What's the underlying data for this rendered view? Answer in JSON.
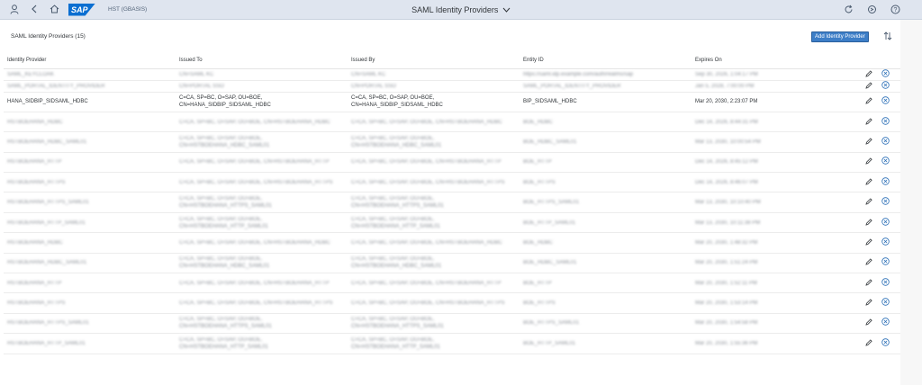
{
  "shell": {
    "system": "HST (GBASIS)",
    "app_title": "SAML Identity Providers",
    "logo_text": "SAP"
  },
  "toolbar": {
    "title": "SAML Identity Providers (15)",
    "add_label": "Add Identity Provider"
  },
  "columns": [
    "Identity Provider",
    "Issued To",
    "Issued By",
    "Entity ID",
    "Expires On"
  ],
  "rows": [
    {
      "idp": "SAML_KEYCLOAK",
      "to": "CN=SAML KC",
      "by": "CN=SAML KC",
      "entity": "https://saml.idp.example.com/auth/realms/sap",
      "exp": "Sep 30, 2026, 1:04:17 PM",
      "two": false,
      "clear": false
    },
    {
      "idp": "SAML_PORTAL_IDENTITY_PROVIDER",
      "to": "CN=PORTAL SSO",
      "by": "CN=PORTAL SSO",
      "entity": "SAML_PORTAL_IDENTITY_PROVIDER",
      "exp": "Jan 5, 2028, 7:00:00 PM",
      "two": false,
      "clear": false
    },
    {
      "idp": "HANA_SIDBIP_SIDSAML_HDBC",
      "to": "C=CA, SP=BC, O=SAP, OU=BOE, CN=HANA_SIDBIP_SIDSAML_HDBC",
      "by": "C=CA, SP=BC, O=SAP, OU=BOE, CN=HANA_SIDBIP_SIDSAML_HDBC",
      "entity": "BIP_SIDSAML_HDBC",
      "exp": "Mar 20, 2030, 2:23:07 PM",
      "two": true,
      "clear": true
    },
    {
      "idp": "HSTBOEHANA_HDBC",
      "to": "C=CA, SP=BC, O=SAP, OU=BOE, CN=HSTBOEHANA_HDBC",
      "by": "C=CA, SP=BC, O=SAP, OU=BOE, CN=HSTBOEHANA_HDBC",
      "entity": "BOE_HDBC",
      "exp": "Dec 14, 2026, 8:44:31 PM",
      "two": true,
      "clear": false
    },
    {
      "idp": "HSTBOEHANA_HDBC_SAML01",
      "to": "C=CA, SP=BC, O=SAP, OU=BOE, CN=HSTBOEHANA_HDBC_SAML01",
      "by": "C=CA, SP=BC, O=SAP, OU=BOE, CN=HSTBOEHANA_HDBC_SAML01",
      "entity": "BOE_HDBC_SAML01",
      "exp": "Mar 13, 2030, 10:00:54 PM",
      "two": true,
      "clear": false
    },
    {
      "idp": "HSTBOEHANA_HTTP",
      "to": "C=CA, SP=BC, O=SAP, OU=BOE, CN=HSTBOEHANA_HTTP",
      "by": "C=CA, SP=BC, O=SAP, OU=BOE, CN=HSTBOEHANA_HTTP",
      "entity": "BOE_HTTP",
      "exp": "Dec 14, 2026, 8:45:12 PM",
      "two": true,
      "clear": false
    },
    {
      "idp": "HSTBOEHANA_HTTPS",
      "to": "C=CA, SP=BC, O=SAP, OU=BOE, CN=HSTBOEHANA_HTTPS",
      "by": "C=CA, SP=BC, O=SAP, OU=BOE, CN=HSTBOEHANA_HTTPS",
      "entity": "BOE_HTTPS",
      "exp": "Dec 14, 2026, 8:46:07 PM",
      "two": true,
      "clear": false
    },
    {
      "idp": "HSTBOEHANA_HTTPS_SAML01",
      "to": "C=CA, SP=BC, O=SAP, OU=BOE, CN=HSTBOEHANA_HTTPS_SAML01",
      "by": "C=CA, SP=BC, O=SAP, OU=BOE, CN=HSTBOEHANA_HTTPS_SAML01",
      "entity": "BOE_HTTPS_SAML01",
      "exp": "Mar 13, 2030, 10:10:40 PM",
      "two": true,
      "clear": false
    },
    {
      "idp": "HSTBOEHANA_HTTP_SAML01",
      "to": "C=CA, SP=BC, O=SAP, OU=BOE, CN=HSTBOEHANA_HTTP_SAML01",
      "by": "C=CA, SP=BC, O=SAP, OU=BOE, CN=HSTBOEHANA_HTTP_SAML01",
      "entity": "BOE_HTTP_SAML01",
      "exp": "Mar 13, 2030, 10:11:38 PM",
      "two": true,
      "clear": false
    },
    {
      "idp": "HSTBOEHANA_HDBC",
      "to": "C=CA, SP=BC, O=SAP, OU=BOE, CN=HSTBOEHANA_HDBC",
      "by": "C=CA, SP=BC, O=SAP, OU=BOE, CN=HSTBOEHANA_HDBC",
      "entity": "BOE_HDBC",
      "exp": "Mar 20, 2030, 1:48:32 PM",
      "two": true,
      "clear": false
    },
    {
      "idp": "HSTBOEHANA_HDBC_SAML01",
      "to": "C=CA, SP=BC, O=SAP, OU=BOE, CN=HSTBOEHANA_HDBC_SAML01",
      "by": "C=CA, SP=BC, O=SAP, OU=BOE, CN=HSTBOEHANA_HDBC_SAML01",
      "entity": "BOE_HDBC_SAML01",
      "exp": "Mar 20, 2030, 1:51:24 PM",
      "two": true,
      "clear": false
    },
    {
      "idp": "HSTBOEHANA_HTTP",
      "to": "C=CA, SP=BC, O=SAP, OU=BOE, CN=HSTBOEHANA_HTTP",
      "by": "C=CA, SP=BC, O=SAP, OU=BOE, CN=HSTBOEHANA_HTTP",
      "entity": "BOE_HTTP",
      "exp": "Mar 20, 2030, 1:52:11 PM",
      "two": true,
      "clear": false
    },
    {
      "idp": "HSTBOEHANA_HTTPS",
      "to": "C=CA, SP=BC, O=SAP, OU=BOE, CN=HSTBOEHANA_HTTPS",
      "by": "C=CA, SP=BC, O=SAP, OU=BOE, CN=HSTBOEHANA_HTTPS",
      "entity": "BOE_HTTPS",
      "exp": "Mar 20, 2030, 1:53:14 PM",
      "two": true,
      "clear": false
    },
    {
      "idp": "HSTBOEHANA_HTTPS_SAML01",
      "to": "C=CA, SP=BC, O=SAP, OU=BOE, CN=HSTBOEHANA_HTTPS_SAML01",
      "by": "C=CA, SP=BC, O=SAP, OU=BOE, CN=HSTBOEHANA_HTTPS_SAML01",
      "entity": "BOE_HTTPS_SAML01",
      "exp": "Mar 20, 2030, 1:54:58 PM",
      "two": true,
      "clear": false
    },
    {
      "idp": "HSTBOEHANA_HTTP_SAML01",
      "to": "C=CA, SP=BC, O=SAP, OU=BOE, CN=HSTBOEHANA_HTTP_SAML01",
      "by": "C=CA, SP=BC, O=SAP, OU=BOE, CN=HSTBOEHANA_HTTP_SAML01",
      "entity": "BOE_HTTP_SAML01",
      "exp": "Mar 20, 2030, 1:55:36 PM",
      "two": true,
      "clear": false
    }
  ],
  "icons": {
    "user": "user-icon",
    "back": "back-icon",
    "home": "home-icon",
    "refresh": "refresh-icon",
    "sync": "sync-icon",
    "help": "help-icon",
    "sort": "sort-icon",
    "edit": "edit-icon",
    "delete": "delete-icon"
  },
  "colors": {
    "shell_bg": "#dfe5ef",
    "accent": "#3d7ec7",
    "delete": "#2b6fb7"
  }
}
